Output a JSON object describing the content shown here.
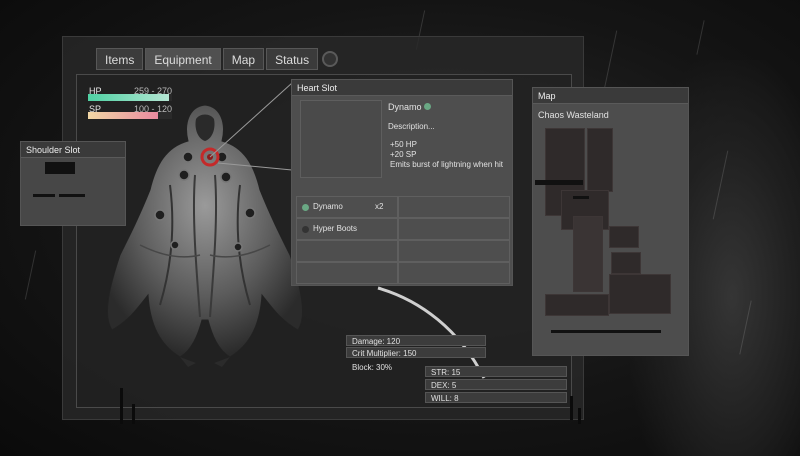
{
  "tabs": [
    {
      "label": "Items"
    },
    {
      "label": "Equipment"
    },
    {
      "label": "Map"
    },
    {
      "label": "Status"
    }
  ],
  "vitals": {
    "hp": {
      "label": "HP",
      "value": "259 - 270",
      "fill": 0.96,
      "color": "#4fd1a3"
    },
    "sp": {
      "label": "SP",
      "value": "100 - 120",
      "fill": 0.83,
      "color": "#e98aa0"
    }
  },
  "shoulder_slot": {
    "title": "Shoulder Slot"
  },
  "heart_slot": {
    "title": "Heart Slot",
    "item_name": "Dynamo",
    "description": "Description...",
    "effects": "+50 HP\n+20 SP\nEmits burst of lightning when hit",
    "inventory": [
      {
        "name": "Dynamo",
        "count": "x2",
        "dot_color": "#6aa884"
      },
      {
        "name": "Hyper Boots",
        "count": "",
        "dot_color": "#333333"
      }
    ]
  },
  "map": {
    "title": "Map",
    "area": "Chaos Wasteland"
  },
  "combat_stats": [
    {
      "label": "Damage: 120"
    },
    {
      "label": "Crit Multiplier: 150"
    },
    {
      "label": "Block: 30%"
    }
  ],
  "attributes": [
    {
      "label": "STR: 15"
    },
    {
      "label": "DEX: 5"
    },
    {
      "label": "WILL: 8"
    }
  ]
}
